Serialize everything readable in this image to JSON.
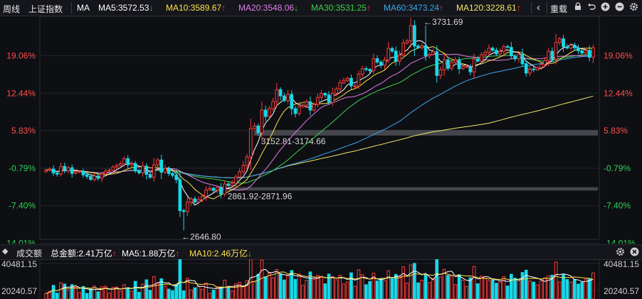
{
  "header": {
    "period_label": "周线",
    "index_name": "上证指数",
    "indicator": "MA",
    "ma_items": [
      {
        "label": "MA5:3572.53",
        "arrow": "↓",
        "color": "#ffffff",
        "arrow_color": "#2ad14a"
      },
      {
        "label": "MA10:3589.67",
        "arrow": "↑",
        "color": "#ffe14d",
        "arrow_color": "#ff3b3b"
      },
      {
        "label": "MA20:3548.06",
        "arrow": "↓",
        "color": "#e07be8",
        "arrow_color": "#2ad14a"
      },
      {
        "label": "MA30:3531.25",
        "arrow": "↑",
        "color": "#3fcf4f",
        "arrow_color": "#ff3b3b"
      },
      {
        "label": "MA60:3473.24",
        "arrow": "↑",
        "color": "#3aa8f0",
        "arrow_color": "#ff3b3b"
      },
      {
        "label": "MA120:3228.61",
        "arrow": "↑",
        "color": "#f2e96a",
        "arrow_color": "#ff3b3b"
      }
    ],
    "nav_left_icon": "‹",
    "reset_label": "重载",
    "icons": [
      "lock-icon",
      "undo-icon",
      "zoom-in-icon",
      "zoom-out-icon",
      "settings-icon"
    ]
  },
  "colors": {
    "up": "#ff3b3b",
    "down": "#17d9e8",
    "pct_up": "#ff4d4d",
    "pct_down": "#2fd15a",
    "grid": "#23252c"
  },
  "chart_data": {
    "type": "candlestick",
    "title": "上证指数 周线",
    "y_pct_ticks": [
      "19.06%",
      "12.44%",
      "5.83%",
      "-0.79%",
      "-7.40%",
      "-14.01%"
    ],
    "y_pct_values": [
      19.06,
      12.44,
      5.83,
      -0.79,
      -7.4,
      -14.01
    ],
    "y_price_range": [
      2600,
      3780
    ],
    "annotations": [
      {
        "text": "←3731.69",
        "price": 3731.69,
        "index": 102
      },
      {
        "text": "←2646.80",
        "price": 2646.8,
        "index": 37
      },
      {
        "text": "3152.81-3174.66",
        "low": 3152.81,
        "high": 3174.66,
        "index_start": 57
      },
      {
        "text": "2861.92-2871.96",
        "low": 2861.92,
        "high": 2871.96,
        "index_start": 48
      }
    ],
    "close": [
      2966,
      2972,
      2951,
      2945,
      2986,
      2962,
      2979,
      2949,
      2957,
      2960,
      2941,
      2933,
      2917,
      2935,
      2923,
      2946,
      2961,
      2965,
      2983,
      2991,
      3000,
      3027,
      2995,
      3001,
      2962,
      2952,
      2987,
      2944,
      2928,
      2994,
      3020,
      2955,
      2975,
      2948,
      2939,
      2916,
      2752,
      2747,
      2797,
      2814,
      2798,
      2810,
      2828,
      2862,
      2870,
      2859,
      2874,
      2840,
      2893,
      2885,
      2897,
      2930,
      2958,
      2991,
      3036,
      3186,
      3200,
      3164,
      3284,
      3250,
      3292,
      3329,
      3392,
      3359,
      3334,
      3367,
      3291,
      3266,
      3303,
      3310,
      3328,
      3284,
      3314,
      3351,
      3372,
      3364,
      3324,
      3373,
      3396,
      3428,
      3441,
      3452,
      3412,
      3412,
      3474,
      3503,
      3499,
      3492,
      3556,
      3538,
      3521,
      3549,
      3610,
      3596,
      3543,
      3575,
      3639,
      3650,
      3731,
      3623,
      3614,
      3624,
      3571,
      3579,
      3593,
      3467,
      3497,
      3550,
      3505,
      3536,
      3549,
      3503,
      3513,
      3515,
      3486,
      3554,
      3543,
      3577,
      3590,
      3612,
      3600,
      3581,
      3594,
      3620,
      3616,
      3571,
      3555,
      3579,
      3529,
      3480,
      3501,
      3497,
      3509,
      3526,
      3546,
      3595,
      3554,
      3642,
      3661,
      3619,
      3612,
      3628,
      3613,
      3598,
      3586,
      3600,
      3563,
      3614
    ],
    "volume_axis_ticks": [
      "40481.15",
      "20240.57"
    ]
  },
  "volume_panel": {
    "title": "成交额",
    "total_label": "总金额:2.41万亿",
    "total_arrow": "↑",
    "ma5_label": "MA5:1.88万亿",
    "ma5_arrow": "↑",
    "ma10_label": "MA10:2.46万亿",
    "ma10_arrow": "↓",
    "icons": [
      "settings-icon",
      "close-icon"
    ]
  }
}
